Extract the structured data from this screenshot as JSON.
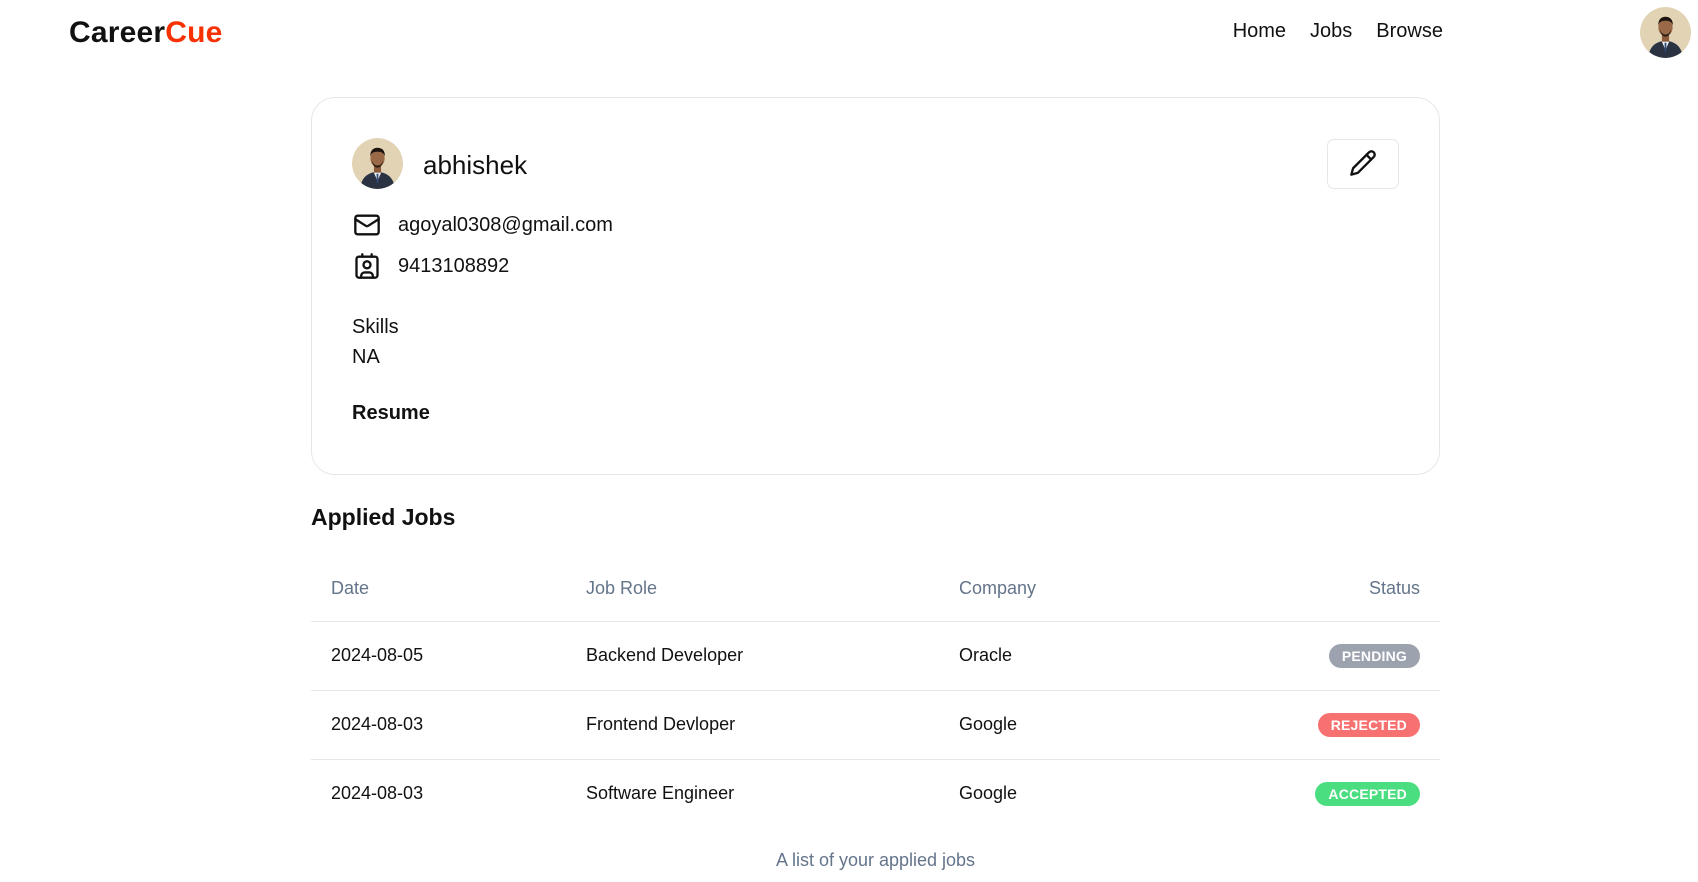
{
  "brand": {
    "part1": "Career",
    "part2": "Cue",
    "accent_color": "#f83002"
  },
  "nav": {
    "links": [
      "Home",
      "Jobs",
      "Browse"
    ]
  },
  "profile": {
    "name": "abhishek",
    "email": "agoyal0308@gmail.com",
    "phone": "9413108892",
    "skills_label": "Skills",
    "skills_value": "NA",
    "resume_label": "Resume",
    "edit_icon": "pencil-icon",
    "email_icon": "mail-icon",
    "phone_icon": "contact-icon"
  },
  "applied_jobs": {
    "title": "Applied Jobs",
    "columns": [
      "Date",
      "Job Role",
      "Company",
      "Status"
    ],
    "rows": [
      {
        "date": "2024-08-05",
        "role": "Backend Developer",
        "company": "Oracle",
        "status": "PENDING",
        "status_color": "#9ca3af"
      },
      {
        "date": "2024-08-03",
        "role": "Frontend Devloper",
        "company": "Google",
        "status": "REJECTED",
        "status_color": "#f87171"
      },
      {
        "date": "2024-08-03",
        "role": "Software Engineer",
        "company": "Google",
        "status": "ACCEPTED",
        "status_color": "#4ade80"
      }
    ],
    "caption": "A list of your applied jobs"
  }
}
